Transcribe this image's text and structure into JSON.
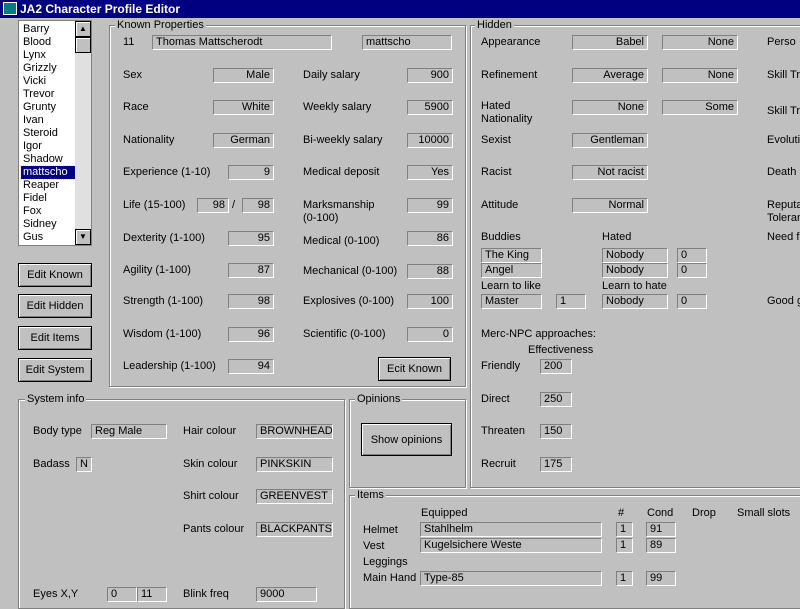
{
  "window": {
    "title": "JA2 Character Profile Editor"
  },
  "character_list": {
    "items": [
      "Barry",
      "Blood",
      "Lynx",
      "Grizzly",
      "Vicki",
      "Trevor",
      "Grunty",
      "Ivan",
      "Steroid",
      "Igor",
      "Shadow",
      "mattscho",
      "Reaper",
      "Fidel",
      "Fox",
      "Sidney",
      "Gus"
    ],
    "selected": "mattscho"
  },
  "side_buttons": {
    "edit_known": "Edit Known",
    "edit_hidden": "Edit Hidden",
    "edit_items": "Edit Items",
    "edit_system": "Edit System"
  },
  "known": {
    "title": "Known Properties",
    "id": "11",
    "full_name": "Thomas  Mattscherodt",
    "nickname": "mattscho",
    "sex_label": "Sex",
    "sex": "Male",
    "race_label": "Race",
    "race": "White",
    "nationality_label": "Nationality",
    "nationality": "German",
    "experience_label": "Experience (1-10)",
    "experience": "9",
    "life_label": "Life (15-100)",
    "life": "98",
    "life_sep": "/",
    "life_max": "98",
    "dexterity_label": "Dexterity (1-100)",
    "dexterity": "95",
    "agility_label": "Agility (1-100)",
    "agility": "87",
    "strength_label": "Strength (1-100)",
    "strength": "98",
    "wisdom_label": "Wisdom (1-100)",
    "wisdom": "96",
    "leadership_label": "Leadership (1-100)",
    "leadership": "94",
    "daily_salary_label": "Daily salary",
    "daily_salary": "900",
    "weekly_salary_label": "Weekly salary",
    "weekly_salary": "5900",
    "biweekly_salary_label": "Bi-weekly salary",
    "biweekly_salary": "10000",
    "medical_deposit_label": "Medical deposit",
    "medical_deposit": "Yes",
    "marksmanship_label": "Marksmanship\n(0-100)",
    "marksmanship": "99",
    "medical_label": "Medical (0-100)",
    "medical": "86",
    "mechanical_label": "Mechanical (0-100)",
    "mechanical": "88",
    "explosives_label": "Explosives (0-100)",
    "explosives": "100",
    "scientific_label": "Scientific (0-100)",
    "scientific": "0",
    "edit_button": "Ecit Known"
  },
  "hidden": {
    "title": "Hidden",
    "appearance_label": "Appearance",
    "appearance": "Babel",
    "appearance2": "None",
    "refinement_label": "Refinement",
    "refinement": "Average",
    "refinement2": "None",
    "hated_nationality_label": "Hated\nNationality",
    "hated_nationality": "None",
    "hated_nationality2": "Some",
    "sexist_label": "Sexist",
    "sexist": "Gentleman",
    "racist_label": "Racist",
    "racist": "Not racist",
    "attitude_label": "Attitude",
    "attitude": "Normal",
    "buddies_label": "Buddies",
    "buddy1": "The King",
    "buddy2": "Angel",
    "hated_label": "Hated",
    "hated1": "Nobody",
    "hated1_val": "0",
    "hated2": "Nobody",
    "hated2_val": "0",
    "learn_like_label": "Learn to like",
    "learn_like": "Master",
    "learn_like_val": "1",
    "learn_hate_label": "Learn to hate",
    "learn_hate": "Nobody",
    "learn_hate_val": "0",
    "approaches_label": "Merc-NPC approaches:",
    "effectiveness_label": "Effectiveness",
    "friendly_label": "Friendly",
    "friendly": "200",
    "direct_label": "Direct",
    "direct": "250",
    "threaten_label": "Threaten",
    "threaten": "150",
    "recruit_label": "Recruit",
    "recruit": "175",
    "right_labels": [
      "Perso",
      "Skill Tr",
      "Skill Tr",
      "Evoluti",
      "Death",
      "Reputa\nToleran",
      "Need f",
      "Good g"
    ]
  },
  "system": {
    "title": "System info",
    "body_type_label": "Body type",
    "body_type": "Reg Male",
    "badass_label": "Badass",
    "badass": "N",
    "hair_colour_label": "Hair colour",
    "hair_colour": "BROWNHEAD",
    "skin_colour_label": "Skin colour",
    "skin_colour": "PINKSKIN",
    "shirt_colour_label": "Shirt colour",
    "shirt_colour": "GREENVEST",
    "pants_colour_label": "Pants colour",
    "pants_colour": "BLACKPANTS",
    "eyes_xy_label": "Eyes X,Y",
    "eyes_x": "0",
    "eyes_y": "11",
    "blink_freq_label": "Blink freq",
    "blink_freq": "9000"
  },
  "opinions": {
    "title": "Opinions",
    "button": "Show opinions"
  },
  "items": {
    "title": "Items",
    "equipped_header": "Equipped",
    "count_header": "#",
    "cond_header": "Cond",
    "drop_header": "Drop",
    "small_slots_header": "Small slots",
    "rows": [
      {
        "slot": "Helmet",
        "item": "Stahlhelm",
        "count": "1",
        "cond": "91"
      },
      {
        "slot": "Vest",
        "item": "Kugelsichere Weste",
        "count": "1",
        "cond": "89"
      },
      {
        "slot": "Leggings",
        "item": "",
        "count": "",
        "cond": ""
      },
      {
        "slot": "Main Hand",
        "item": "Type-85",
        "count": "1",
        "cond": "99"
      }
    ]
  }
}
